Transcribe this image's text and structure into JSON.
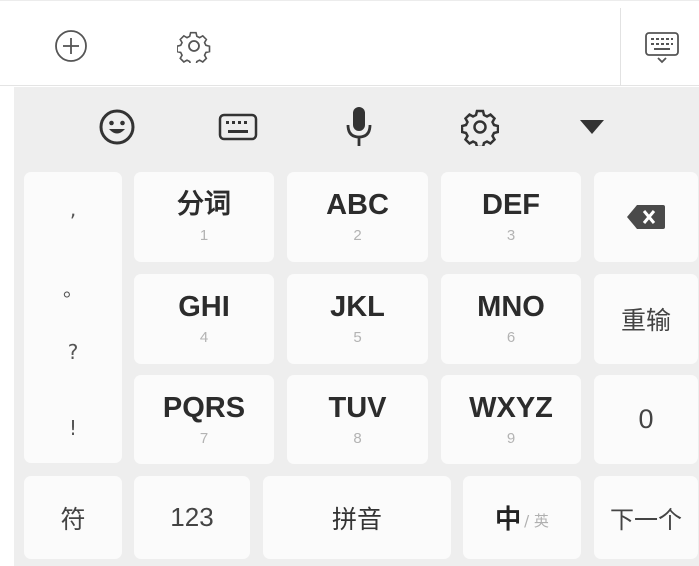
{
  "toolbar_top": {
    "add_icon": "plus-circle-icon",
    "settings_icon": "gear-icon",
    "keyboard_hide_icon": "keyboard-down-icon"
  },
  "toolbar_second": {
    "icons": [
      "smiley-icon",
      "keyboard-icon",
      "microphone-icon",
      "gear-icon",
      "collapse-triangle-icon"
    ]
  },
  "punctuation": [
    ",",
    "。",
    "?",
    "!"
  ],
  "keys": {
    "row1": [
      {
        "label": "分词",
        "num": "1"
      },
      {
        "label": "ABC",
        "num": "2"
      },
      {
        "label": "DEF",
        "num": "3"
      }
    ],
    "row2": [
      {
        "label": "GHI",
        "num": "4"
      },
      {
        "label": "JKL",
        "num": "5"
      },
      {
        "label": "MNO",
        "num": "6"
      }
    ],
    "row3": [
      {
        "label": "PQRS",
        "num": "7"
      },
      {
        "label": "TUV",
        "num": "8"
      },
      {
        "label": "WXYZ",
        "num": "9"
      }
    ]
  },
  "right_col": {
    "delete_icon": "backspace-icon",
    "reenter": "重输",
    "zero": "0",
    "next": "下一个"
  },
  "bottom_row": {
    "symbols": "符",
    "numbers": "123",
    "pinyin": "拼音",
    "lang_main": "中",
    "lang_alt": "/ 英"
  }
}
